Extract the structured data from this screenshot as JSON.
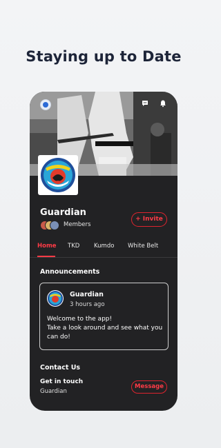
{
  "headline": "Staying up to Date",
  "top_bar": {
    "avatar_icon": "user-avatar",
    "chat_icon": "chat-bubble-icon",
    "bell_icon": "bell-icon"
  },
  "group": {
    "name": "Guardian",
    "members_label": "Members",
    "invite_label": "+ Invite"
  },
  "tabs": [
    {
      "label": "Home"
    },
    {
      "label": "TKD"
    },
    {
      "label": "Kumdo"
    },
    {
      "label": "White Belt"
    }
  ],
  "announcements": {
    "title": "Announcements",
    "author": "Guardian",
    "time": "3 hours ago",
    "body": "Welcome to the app!\nTake a look around and see what you can do!"
  },
  "contact": {
    "title": "Contact Us",
    "get_in_touch": "Get in touch",
    "subtitle": "Guardian",
    "message_label": "Message"
  },
  "colors": {
    "accent": "#ff3b46",
    "phone_bg": "#222224",
    "page_bg": "#f3f4f6",
    "headline": "#1d2438"
  }
}
